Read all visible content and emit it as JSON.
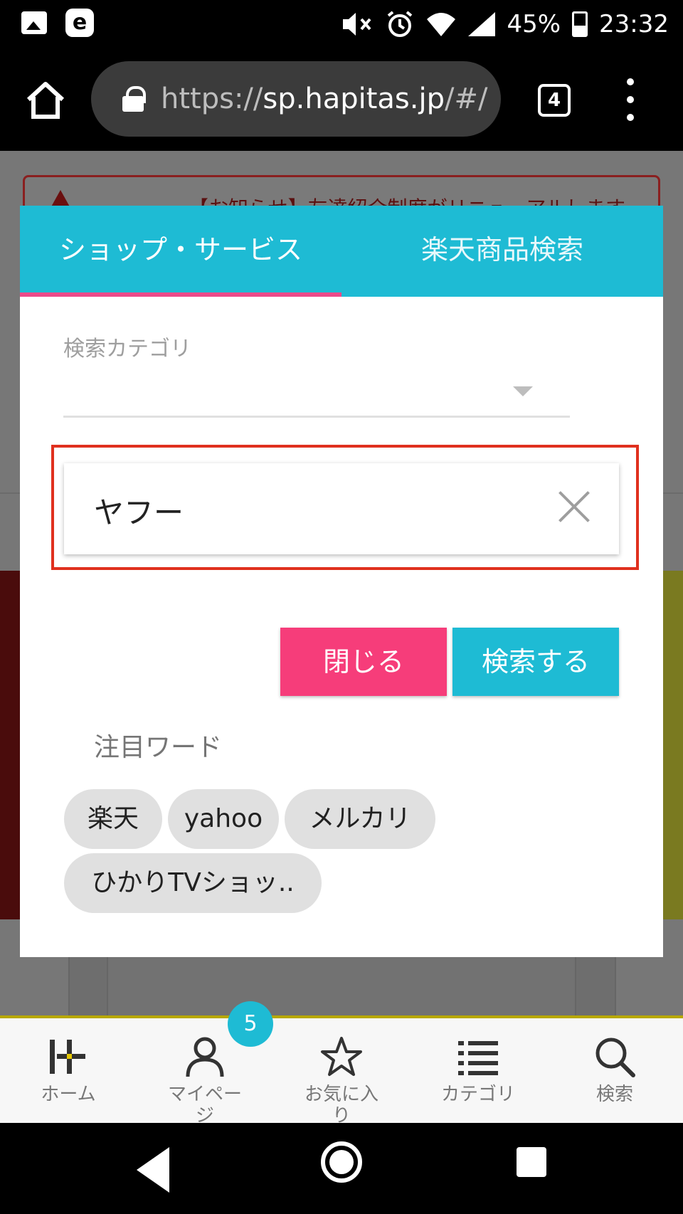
{
  "status_bar": {
    "battery": "45%",
    "time": "23:32"
  },
  "browser": {
    "url_scheme": "https://",
    "url_host": "sp.hapitas.jp",
    "url_path": "/#/",
    "tab_count": "4"
  },
  "background": {
    "notice_text": "【お知らせ】友達紹介制度がリニューアルします"
  },
  "search_modal": {
    "tabs": [
      {
        "label": "ショップ・サービス",
        "active": true
      },
      {
        "label": "楽天商品検索",
        "active": false
      }
    ],
    "category_label": "検索カテゴリ",
    "category_value": "",
    "search_value": "ヤフー",
    "close_label": "閉じる",
    "search_label": "検索する",
    "hot_words_title": "注目ワード",
    "hot_words": [
      "楽天",
      "yahoo",
      "メルカリ",
      "ひかりTVショッ.."
    ]
  },
  "bottom_nav": {
    "items": [
      {
        "label": "ホーム",
        "icon": "home-plus-icon"
      },
      {
        "label": "マイページ",
        "icon": "person-icon"
      },
      {
        "label": "お気に入り",
        "icon": "star-icon"
      },
      {
        "label": "カテゴリ",
        "icon": "list-icon"
      },
      {
        "label": "検索",
        "icon": "search-icon"
      }
    ],
    "mypage_badge": "5"
  },
  "colors": {
    "accent_cyan": "#1ebbd4",
    "accent_pink": "#f63d7a",
    "highlight_red": "#e0301e"
  }
}
